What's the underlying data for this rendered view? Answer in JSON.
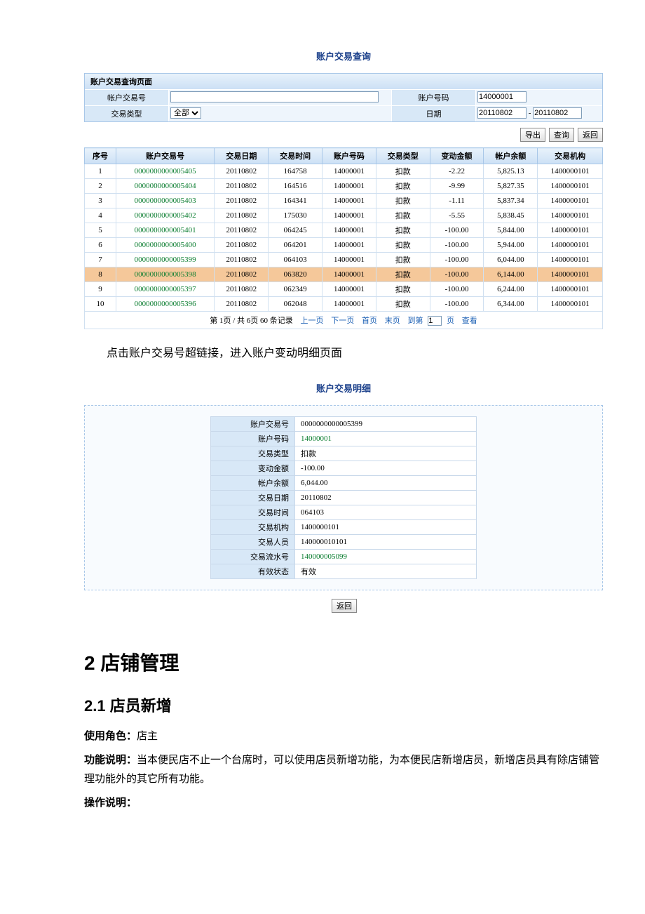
{
  "queryTitle": "账户交易查询",
  "queryPanel": {
    "header": "账户交易查询页面",
    "label_txn_no": "帐户交易号",
    "label_acct_no": "账户号码",
    "acct_no_value": "14000001",
    "label_txn_type": "交易类型",
    "txn_type_value": "全部",
    "label_date": "日期",
    "date_from": "20110802",
    "date_sep": "-",
    "date_to": "20110802"
  },
  "buttons": {
    "export": "导出",
    "query": "查询",
    "back": "返回"
  },
  "table": {
    "headers": [
      "序号",
      "账户交易号",
      "交易日期",
      "交易时间",
      "账户号码",
      "交易类型",
      "变动金额",
      "帐户余额",
      "交易机构"
    ],
    "rows": [
      {
        "seq": "1",
        "txn": "0000000000005405",
        "date": "20110802",
        "time": "164758",
        "acct": "14000001",
        "type": "扣款",
        "amt": "-2.22",
        "bal": "5,825.13",
        "org": "1400000101",
        "hl": false
      },
      {
        "seq": "2",
        "txn": "0000000000005404",
        "date": "20110802",
        "time": "164516",
        "acct": "14000001",
        "type": "扣款",
        "amt": "-9.99",
        "bal": "5,827.35",
        "org": "1400000101",
        "hl": false
      },
      {
        "seq": "3",
        "txn": "0000000000005403",
        "date": "20110802",
        "time": "164341",
        "acct": "14000001",
        "type": "扣款",
        "amt": "-1.11",
        "bal": "5,837.34",
        "org": "1400000101",
        "hl": false
      },
      {
        "seq": "4",
        "txn": "0000000000005402",
        "date": "20110802",
        "time": "175030",
        "acct": "14000001",
        "type": "扣款",
        "amt": "-5.55",
        "bal": "5,838.45",
        "org": "1400000101",
        "hl": false
      },
      {
        "seq": "5",
        "txn": "0000000000005401",
        "date": "20110802",
        "time": "064245",
        "acct": "14000001",
        "type": "扣款",
        "amt": "-100.00",
        "bal": "5,844.00",
        "org": "1400000101",
        "hl": false
      },
      {
        "seq": "6",
        "txn": "0000000000005400",
        "date": "20110802",
        "time": "064201",
        "acct": "14000001",
        "type": "扣款",
        "amt": "-100.00",
        "bal": "5,944.00",
        "org": "1400000101",
        "hl": false
      },
      {
        "seq": "7",
        "txn": "0000000000005399",
        "date": "20110802",
        "time": "064103",
        "acct": "14000001",
        "type": "扣款",
        "amt": "-100.00",
        "bal": "6,044.00",
        "org": "1400000101",
        "hl": false
      },
      {
        "seq": "8",
        "txn": "0000000000005398",
        "date": "20110802",
        "time": "063820",
        "acct": "14000001",
        "type": "扣款",
        "amt": "-100.00",
        "bal": "6,144.00",
        "org": "1400000101",
        "hl": true
      },
      {
        "seq": "9",
        "txn": "0000000000005397",
        "date": "20110802",
        "time": "062349",
        "acct": "14000001",
        "type": "扣款",
        "amt": "-100.00",
        "bal": "6,244.00",
        "org": "1400000101",
        "hl": false
      },
      {
        "seq": "10",
        "txn": "0000000000005396",
        "date": "20110802",
        "time": "062048",
        "acct": "14000001",
        "type": "扣款",
        "amt": "-100.00",
        "bal": "6,344.00",
        "org": "1400000101",
        "hl": false
      }
    ]
  },
  "pager": {
    "text_prefix": "第 1页 / 共 6页 60 条记录",
    "prev": "上一页",
    "next": "下一页",
    "first": "首页",
    "last": "末页",
    "goto": "到第",
    "page_input": "1",
    "page_suffix": "页",
    "view": "查看"
  },
  "linkInstruction": "点击账户交易号超链接，进入账户变动明细页面",
  "detailTitle": "账户交易明细",
  "detail": {
    "rows": [
      {
        "label": "账户交易号",
        "value": "0000000000005399",
        "link": false
      },
      {
        "label": "账户号码",
        "value": "14000001",
        "link": true
      },
      {
        "label": "交易类型",
        "value": "扣款",
        "link": false
      },
      {
        "label": "变动金额",
        "value": "-100.00",
        "link": false
      },
      {
        "label": "帐户余额",
        "value": "6,044.00",
        "link": false
      },
      {
        "label": "交易日期",
        "value": "20110802",
        "link": false
      },
      {
        "label": "交易时间",
        "value": "064103",
        "link": false
      },
      {
        "label": "交易机构",
        "value": "1400000101",
        "link": false
      },
      {
        "label": "交易人员",
        "value": "140000010101",
        "link": false
      },
      {
        "label": "交易流水号",
        "value": "140000005099",
        "link": true
      },
      {
        "label": "有效状态",
        "value": "有效",
        "link": false
      }
    ]
  },
  "detail_back": "返回",
  "section2": {
    "h1": "2 店铺管理",
    "h2": "2.1 店员新增",
    "role_label": "使用角色：",
    "role_value": "店主",
    "func_label": "功能说明：",
    "func_value": "当本便民店不止一个台席时，可以使用店员新增功能，为本便民店新增店员，新增店员具有除店铺管理功能外的其它所有功能。",
    "op_label": "操作说明："
  }
}
